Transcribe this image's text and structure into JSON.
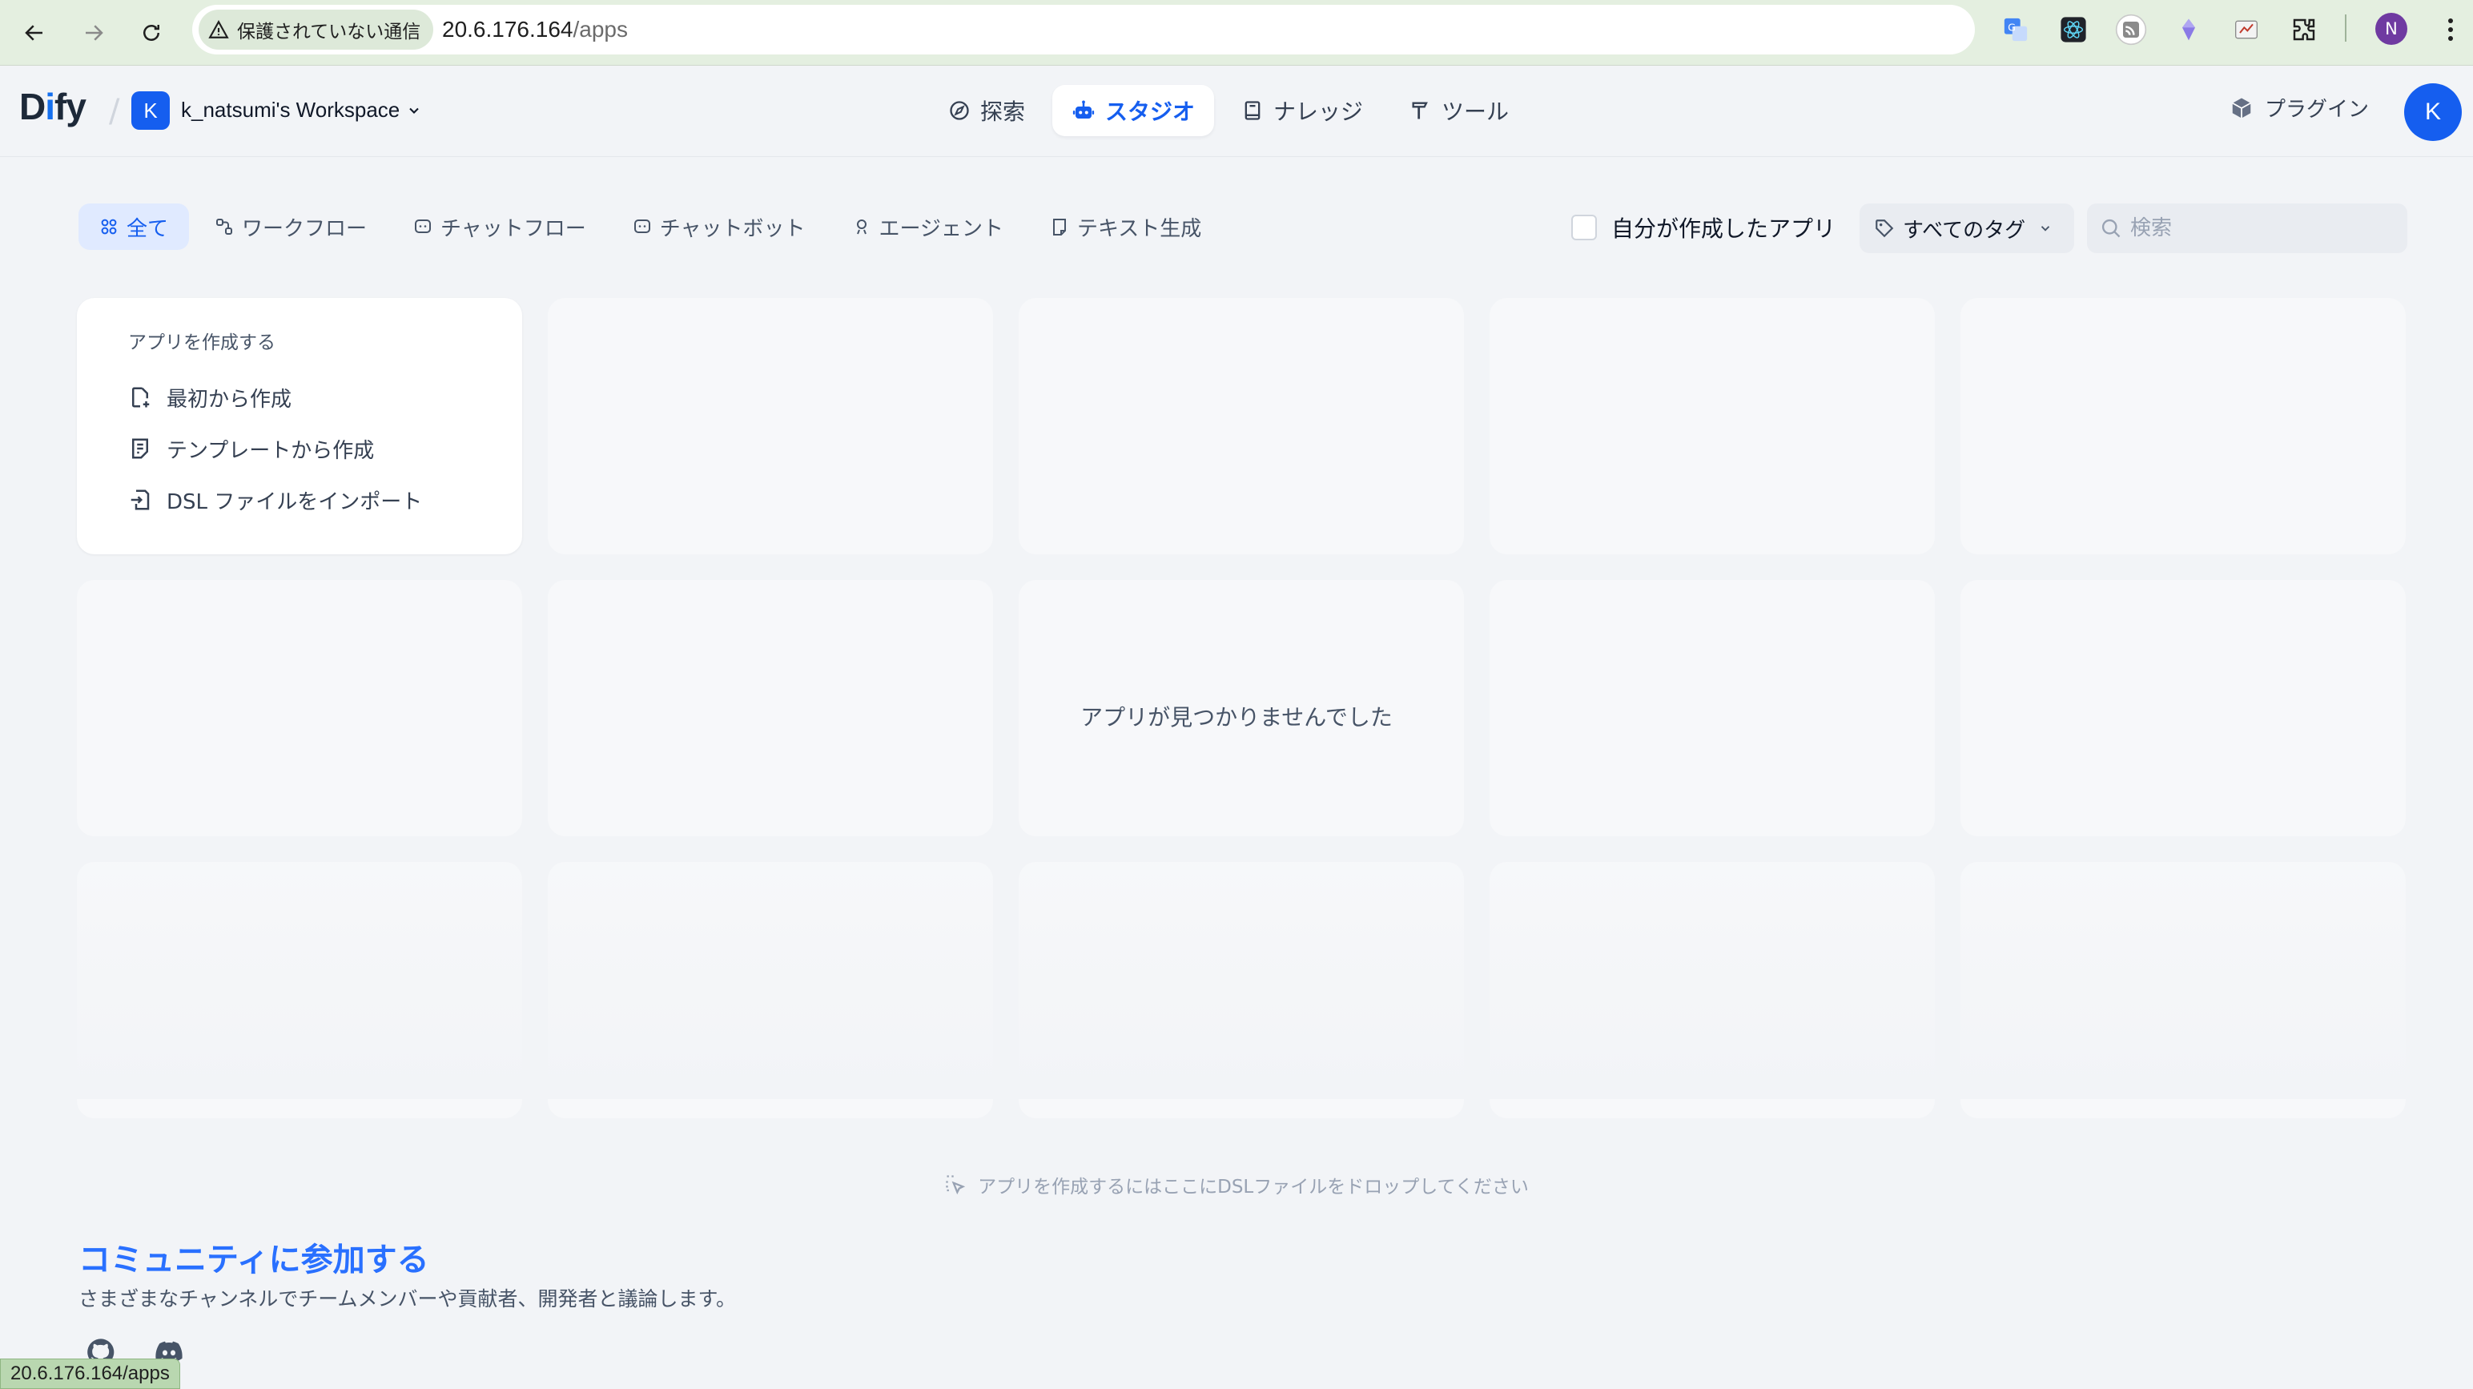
{
  "browser": {
    "security_label": "保護されていない通信",
    "url_host": "20.6.176.164",
    "url_path": "/apps",
    "profile_initial": "N",
    "status_url": "20.6.176.164/apps"
  },
  "header": {
    "logo_pre": "D",
    "logo_i": "i",
    "logo_post": "fy",
    "workspace_initial": "K",
    "workspace_name": "k_natsumi's Workspace",
    "nav": [
      {
        "label": "探索",
        "icon": "explore-icon"
      },
      {
        "label": "スタジオ",
        "icon": "robot-icon"
      },
      {
        "label": "ナレッジ",
        "icon": "book-icon"
      },
      {
        "label": "ツール",
        "icon": "hammer-icon"
      }
    ],
    "plugin_label": "プラグイン",
    "user_initial": "K"
  },
  "filters": {
    "tabs": [
      {
        "label": "全て"
      },
      {
        "label": "ワークフロー"
      },
      {
        "label": "チャットフロー"
      },
      {
        "label": "チャットボット"
      },
      {
        "label": "エージェント"
      },
      {
        "label": "テキスト生成"
      }
    ],
    "mine_label": "自分が作成したアプリ",
    "tag_label": "すべてのタグ",
    "search_placeholder": "検索"
  },
  "create_card": {
    "title": "アプリを作成する",
    "items": [
      {
        "label": "最初から作成"
      },
      {
        "label": "テンプレートから作成"
      },
      {
        "label": "DSL ファイルをインポート"
      }
    ]
  },
  "empty_message": "アプリが見つかりませんでした",
  "drop_hint": "アプリを作成するにはここにDSLファイルをドロップしてください",
  "community": {
    "title": "コミュニティに参加する",
    "description": "さまざまなチャンネルでチームメンバーや貢献者、開発者と議論します。"
  },
  "colors": {
    "accent": "#155eef",
    "link": "#2970ff",
    "background": "#f2f4f7",
    "chrome": "#e4efe0"
  }
}
